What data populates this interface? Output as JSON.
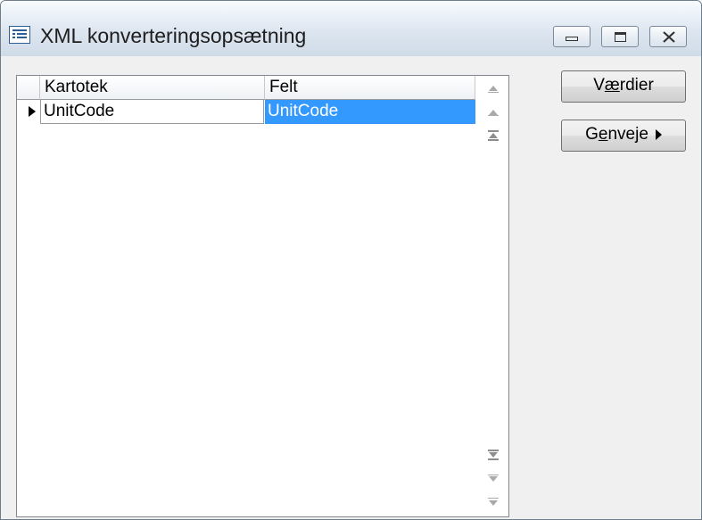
{
  "window": {
    "title": "XML konverteringsopsætning",
    "icon": "form-window-icon",
    "controls": {
      "minimize": "minimize-icon",
      "maximize": "maximize-icon",
      "close": "close-icon"
    }
  },
  "grid": {
    "columns": [
      "Kartotek",
      "Felt"
    ],
    "rows": [
      {
        "kartotek": "UnitCode",
        "felt": "UnitCode",
        "selected": true
      }
    ],
    "scrollbar_icons": [
      "scroll-up-icon",
      "scroll-up-small-icon",
      "scroll-top-icon",
      "scroll-bottom-icon",
      "scroll-down-small-icon",
      "scroll-down-icon"
    ]
  },
  "buttons": {
    "vaerdier": {
      "prefix": "V",
      "accel": "æ",
      "rest": "rdier"
    },
    "genveje": {
      "prefix": "G",
      "accel": "e",
      "rest": "nveje"
    }
  },
  "colors": {
    "selection": "#3399ff",
    "selection_text": "#ffffff"
  }
}
